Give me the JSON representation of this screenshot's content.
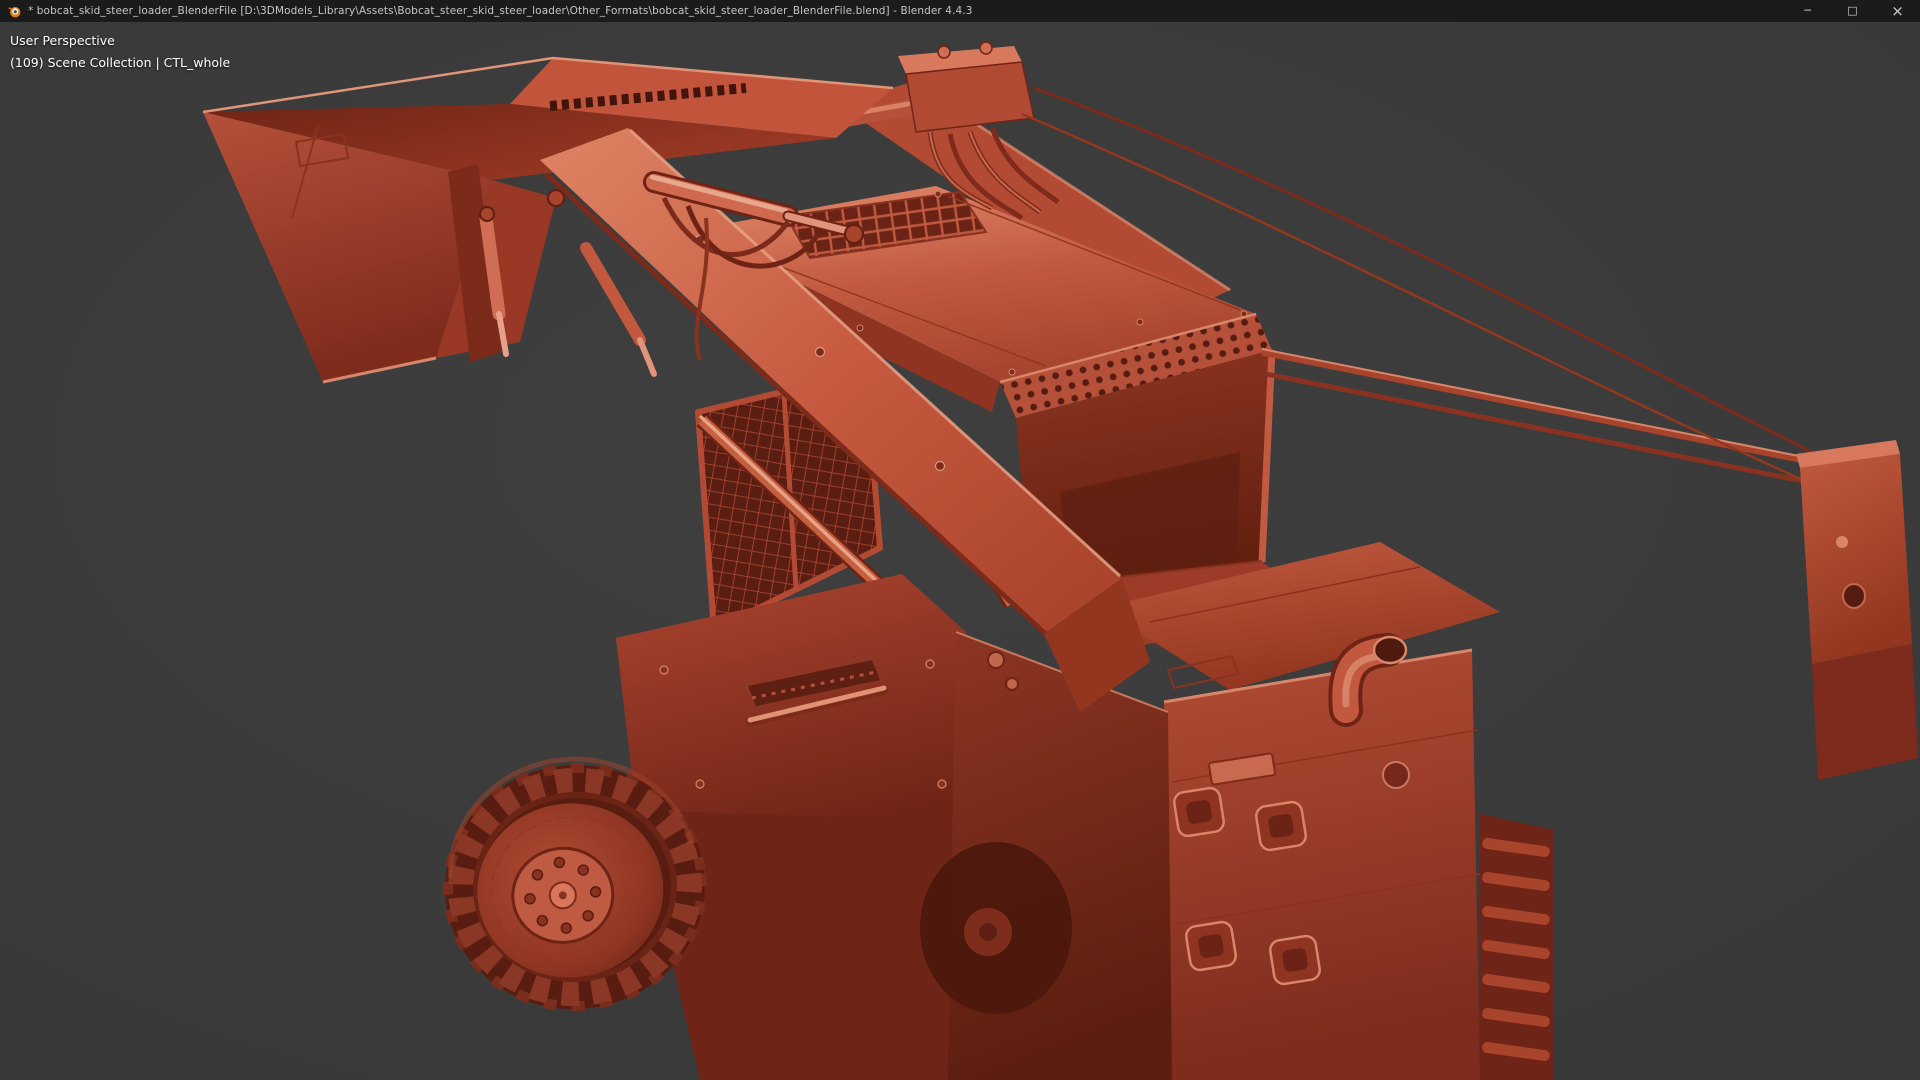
{
  "window": {
    "app_icon": "blender-logo",
    "title": "* bobcat_skid_steer_loader_BlenderFile [D:\\3DModels_Library\\Assets\\Bobcat_steer_skid_steer_loader\\Other_Formats\\bobcat_skid_steer_loader_BlenderFile.blend] - Blender 4.4.3",
    "controls": {
      "minimize": "─",
      "maximize": "□",
      "close": "×"
    }
  },
  "viewport": {
    "overlay": {
      "view_label": "User Perspective",
      "collection_label": "(109) Scene Collection | CTL_whole"
    },
    "background_color": "#3b3b3b",
    "model": {
      "name": "Bobcat skid steer loader",
      "shading": "red clay matcap",
      "colors": {
        "base": "#b04a33",
        "highlight": "#e8a286",
        "shadow": "#5e1f12"
      }
    }
  }
}
